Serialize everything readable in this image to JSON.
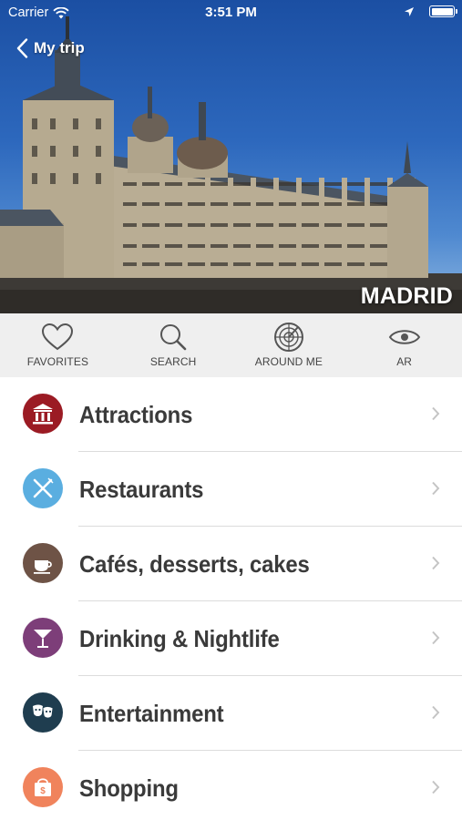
{
  "status_bar": {
    "carrier": "Carrier",
    "time": "3:51 PM"
  },
  "header": {
    "back_label": "My trip",
    "city_name": "MADRID"
  },
  "toolbar": {
    "items": [
      {
        "label": "FAVORITES",
        "icon": "heart-icon"
      },
      {
        "label": "SEARCH",
        "icon": "search-icon"
      },
      {
        "label": "AROUND ME",
        "icon": "radar-icon"
      },
      {
        "label": "AR",
        "icon": "eye-icon"
      }
    ]
  },
  "categories": [
    {
      "label": "Attractions",
      "icon": "museum-icon",
      "color": "#9b1b24"
    },
    {
      "label": "Restaurants",
      "icon": "fork-knife-icon",
      "color": "#5aaee0"
    },
    {
      "label": "Cafés, desserts, cakes",
      "icon": "coffee-cup-icon",
      "color": "#6e5346"
    },
    {
      "label": "Drinking & Nightlife",
      "icon": "cocktail-icon",
      "color": "#7d3e79"
    },
    {
      "label": "Entertainment",
      "icon": "theater-masks-icon",
      "color": "#1f3d4f"
    },
    {
      "label": "Shopping",
      "icon": "shopping-bag-icon",
      "color": "#f0835c"
    }
  ]
}
